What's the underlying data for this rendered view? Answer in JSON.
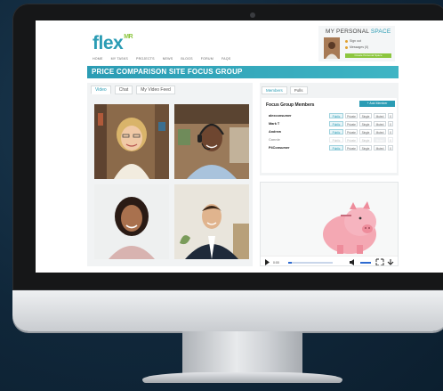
{
  "site": {
    "logo": "flex",
    "logo_sup": "MR",
    "nav": [
      "HOME",
      "MY TASKS",
      "PROJECTS",
      "NEWS",
      "BLOGS",
      "FORUM",
      "FAQS"
    ],
    "banner": "PRICE COMPARISON SITE FOCUS GROUP"
  },
  "personal_space": {
    "title_a": "MY PERSONAL",
    "title_b": "SPACE",
    "rows": [
      "Sign out",
      "Messages (0)"
    ],
    "button": "Create Personal Space"
  },
  "left_panel": {
    "tabs": [
      "Video",
      "Chat",
      "My Video Feed"
    ],
    "active_tab": "Video"
  },
  "right_panel": {
    "tabs": [
      "Members",
      "Polls"
    ],
    "active_tab": "Members",
    "members_title": "Focus Group Members",
    "add_button": "Add Member",
    "permissions": [
      "Public",
      "Private",
      "Single",
      "Muted",
      "X"
    ],
    "members": [
      {
        "name": "alexconsumer",
        "active_perm": 0
      },
      {
        "name": "Mark T",
        "active_perm": 0
      },
      {
        "name": "Andrew",
        "active_perm": 0
      },
      {
        "name": "Connie",
        "active_perm": 3,
        "dimmed": true
      },
      {
        "name": "P4Consumer",
        "active_perm": 0
      }
    ]
  },
  "player": {
    "time": "0:00",
    "progress": 0.08,
    "icons": [
      "play-icon",
      "volume-icon",
      "fullscreen-icon",
      "download-icon"
    ]
  },
  "colors": {
    "brand": "#2b9cb4",
    "accent_green": "#8cc63f"
  }
}
